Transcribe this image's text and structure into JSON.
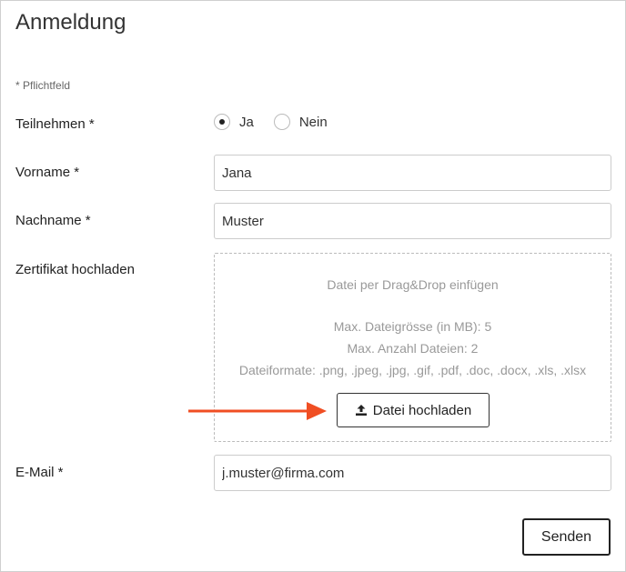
{
  "form": {
    "title": "Anmeldung",
    "required_note": "* Pflichtfeld",
    "participate": {
      "label": "Teilnehmen *",
      "options": [
        {
          "label": "Ja",
          "selected": true
        },
        {
          "label": "Nein",
          "selected": false
        }
      ]
    },
    "firstname": {
      "label": "Vorname *",
      "value": "Jana"
    },
    "lastname": {
      "label": "Nachname *",
      "value": "Muster"
    },
    "certificate": {
      "label": "Zertifikat hochladen",
      "dropzone_hint": "Datei per Drag&Drop einfügen",
      "max_size": "Max. Dateigrösse (in MB): 5",
      "max_files": "Max. Anzahl Dateien: 2",
      "formats": "Dateiformate: .png, .jpeg, .jpg, .gif, .pdf, .doc, .docx, .xls, .xlsx",
      "upload_label": "Datei hochladen",
      "upload_icon": "upload-icon"
    },
    "email": {
      "label": "E-Mail *",
      "value": "j.muster@firma.com"
    },
    "submit_label": "Senden"
  },
  "colors": {
    "arrow": "#f04e23",
    "text": "#222222",
    "muted": "#999999"
  }
}
